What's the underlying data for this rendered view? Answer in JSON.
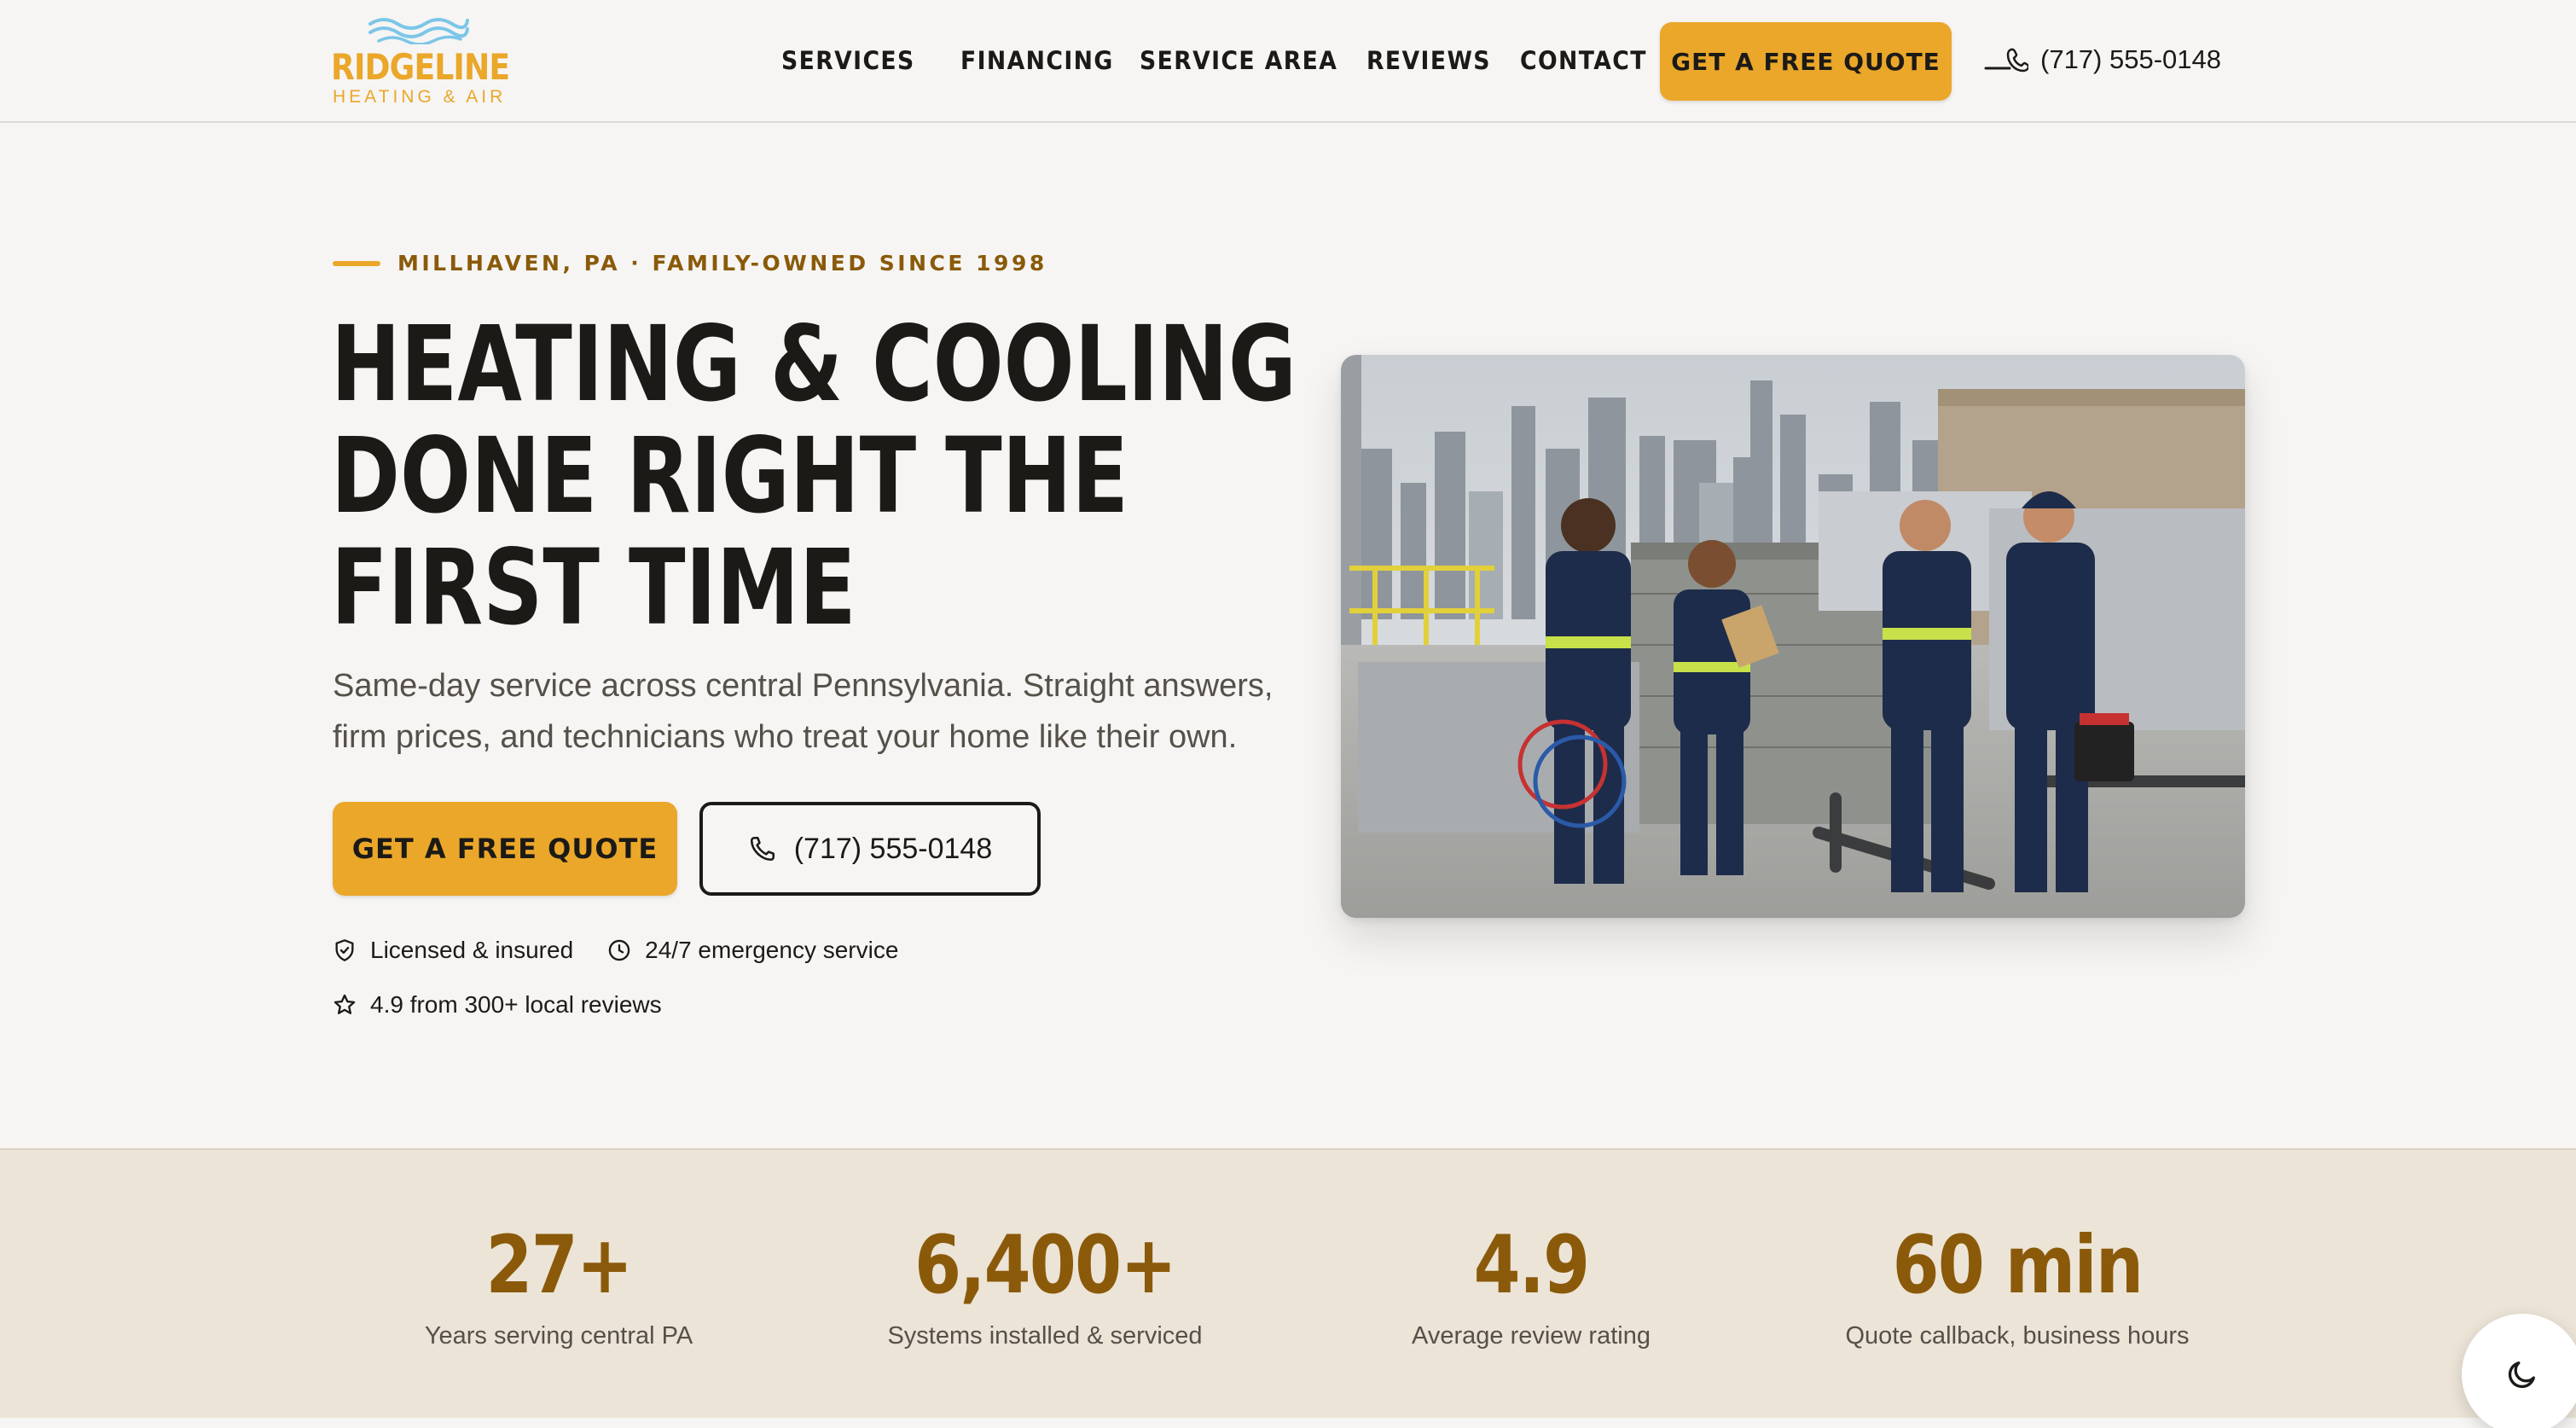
{
  "brand": {
    "name": "RIDGELINE",
    "tagline": "HEATING & AIR",
    "accent": "#eaa72a",
    "dark_accent": "#8a5a0a"
  },
  "nav": {
    "items": [
      "SERVICES",
      "FINANCING",
      "SERVICE AREA",
      "REVIEWS",
      "CONTACT"
    ],
    "cta_label": "GET A FREE QUOTE",
    "phone": "(717) 555-0148"
  },
  "hero": {
    "eyebrow": "MILLHAVEN, PA · FAMILY-OWNED SINCE 1998",
    "headline_lines": [
      "HEATING & COOLING",
      "DONE RIGHT THE",
      "FIRST TIME"
    ],
    "lede": "Same-day service across central Pennsylvania. Straight answers, firm prices, and technicians who treat your home like their own.",
    "primary_cta": "GET A FREE QUOTE",
    "phone_cta": "(717) 555-0148",
    "trust": [
      {
        "icon": "shield-check-icon",
        "label": "Licensed & insured"
      },
      {
        "icon": "clock-icon",
        "label": "24/7 emergency service"
      },
      {
        "icon": "star-icon",
        "label": "4.9 from 300+ local reviews"
      }
    ],
    "photo_icon": "hvac-technicians-rooftop-photo"
  },
  "stats": [
    {
      "value": "27+",
      "label": "Years serving central PA"
    },
    {
      "value": "6,400+",
      "label": "Systems installed & serviced"
    },
    {
      "value": "4.9",
      "label": "Average review rating"
    },
    {
      "value": "60 min",
      "label": "Quote callback, business hours"
    }
  ],
  "theme_toggle": {
    "icon": "moon-icon"
  }
}
